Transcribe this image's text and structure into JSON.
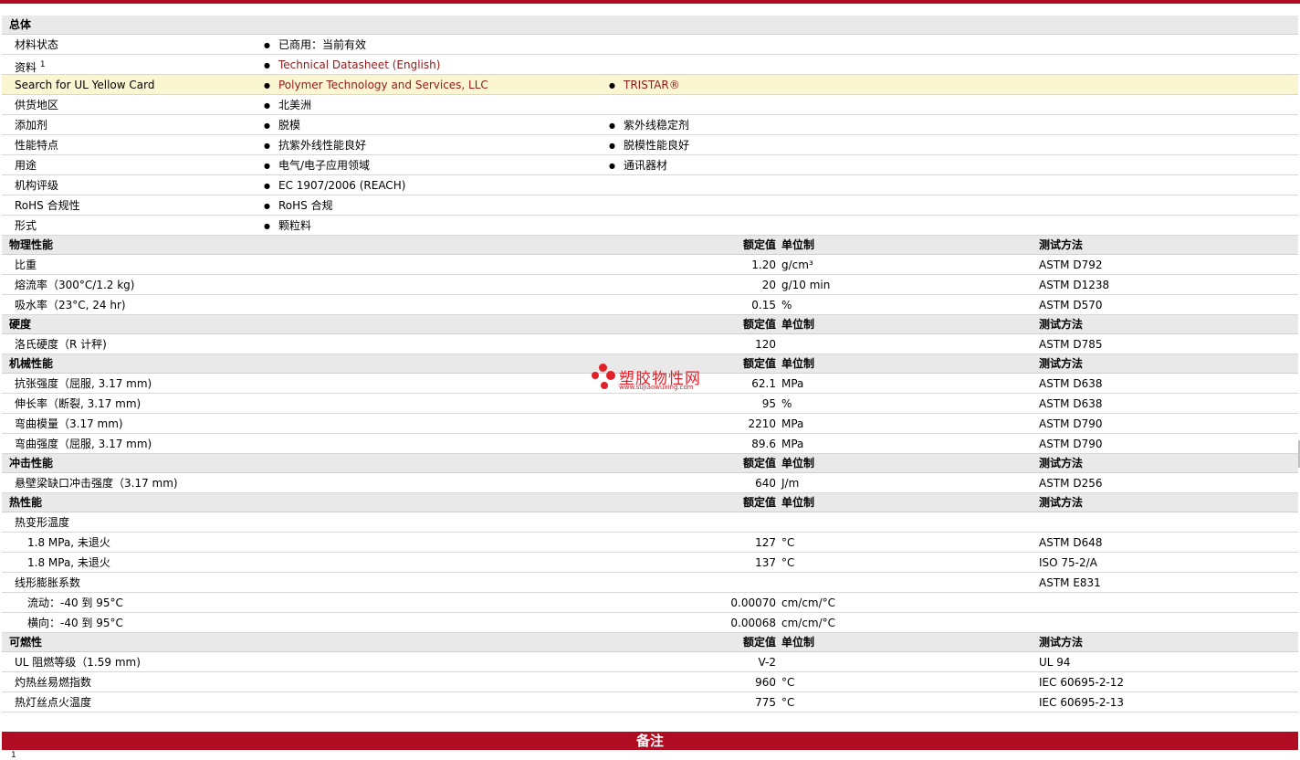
{
  "general": {
    "title": "总体",
    "status_label": "材料状态",
    "status_value": "已商用：当前有效",
    "docs_label": "资料",
    "docs_sup": "1",
    "docs_value": "Technical Datasheet (English)",
    "ul_label": "Search for UL Yellow Card",
    "ul_value1": "Polymer Technology and Services, LLC",
    "ul_value2": "TRISTAR®",
    "region_label": "供货地区",
    "region_value": "北美洲",
    "additive_label": "添加剂",
    "additive_value1": "脱模",
    "additive_value2": "紫外线稳定剂",
    "feature_label": "性能特点",
    "feature_value1": "抗紫外线性能良好",
    "feature_value2": "脱模性能良好",
    "use_label": "用途",
    "use_value1": "电气/电子应用领域",
    "use_value2": "通讯器材",
    "agency_label": "机构评级",
    "agency_value": "EC 1907/2006 (REACH)",
    "rohs_label": "RoHS 合规性",
    "rohs_value": "RoHS 合规",
    "form_label": "形式",
    "form_value": "颗粒料"
  },
  "headers": {
    "nominal": "额定值",
    "unit": "单位制",
    "method": "测试方法"
  },
  "physical": {
    "title": "物理性能",
    "rows": [
      {
        "label": "比重",
        "value": "1.20",
        "unit": "g/cm³",
        "method": "ASTM D792"
      },
      {
        "label": "熔流率（300°C/1.2 kg)",
        "value": "20",
        "unit": "g/10 min",
        "method": "ASTM D1238"
      },
      {
        "label": "吸水率（23°C, 24 hr)",
        "value": "0.15",
        "unit": "%",
        "method": "ASTM D570"
      }
    ]
  },
  "hardness": {
    "title": "硬度",
    "rows": [
      {
        "label": "洛氏硬度（R 计秤)",
        "value": "120",
        "unit": "",
        "method": "ASTM D785"
      }
    ]
  },
  "mechanical": {
    "title": "机械性能",
    "rows": [
      {
        "label": "抗张强度（屈服, 3.17 mm)",
        "value": "62.1",
        "unit": "MPa",
        "method": "ASTM D638"
      },
      {
        "label": "伸长率（断裂, 3.17 mm)",
        "value": "95",
        "unit": "%",
        "method": "ASTM D638"
      },
      {
        "label": "弯曲模量（3.17 mm)",
        "value": "2210",
        "unit": "MPa",
        "method": "ASTM D790"
      },
      {
        "label": "弯曲强度（屈服, 3.17 mm)",
        "value": "89.6",
        "unit": "MPa",
        "method": "ASTM D790"
      }
    ]
  },
  "impact": {
    "title": "冲击性能",
    "rows": [
      {
        "label": "悬壁梁缺口冲击强度（3.17 mm)",
        "value": "640",
        "unit": "J/m",
        "method": "ASTM D256"
      }
    ]
  },
  "thermal": {
    "title": "热性能",
    "hdt_label": "热变形温度",
    "hdt_rows": [
      {
        "label": "1.8 MPa, 未退火",
        "value": "127",
        "unit": "°C",
        "method": "ASTM D648"
      },
      {
        "label": "1.8 MPa, 未退火",
        "value": "137",
        "unit": "°C",
        "method": "ISO 75-2/A"
      }
    ],
    "clte_label": "线形膨胀系数",
    "clte_method": "ASTM E831",
    "clte_rows": [
      {
        "label": "流动：-40 到  95°C",
        "value": "0.00070",
        "unit": "cm/cm/°C"
      },
      {
        "label": "横向：-40 到  95°C",
        "value": "0.00068",
        "unit": "cm/cm/°C"
      }
    ]
  },
  "flammability": {
    "title": "可燃性",
    "rows": [
      {
        "label": "UL 阻燃等级（1.59 mm)",
        "value": "V-2",
        "unit": "",
        "method": "UL 94"
      },
      {
        "label": "灼热丝易燃指数",
        "value": "960",
        "unit": "°C",
        "method": "IEC 60695-2-12"
      },
      {
        "label": "热灯丝点火温度",
        "value": "775",
        "unit": "°C",
        "method": "IEC 60695-2-13"
      }
    ]
  },
  "watermark": {
    "text": "塑胶物性网",
    "url": "www.sujiaowuxing.com"
  },
  "notes": {
    "title": "备注",
    "footnote": "1"
  },
  "colors": {
    "accent": "#b10d22",
    "highlight": "#fbf6d2",
    "section": "#e9e9e9"
  }
}
